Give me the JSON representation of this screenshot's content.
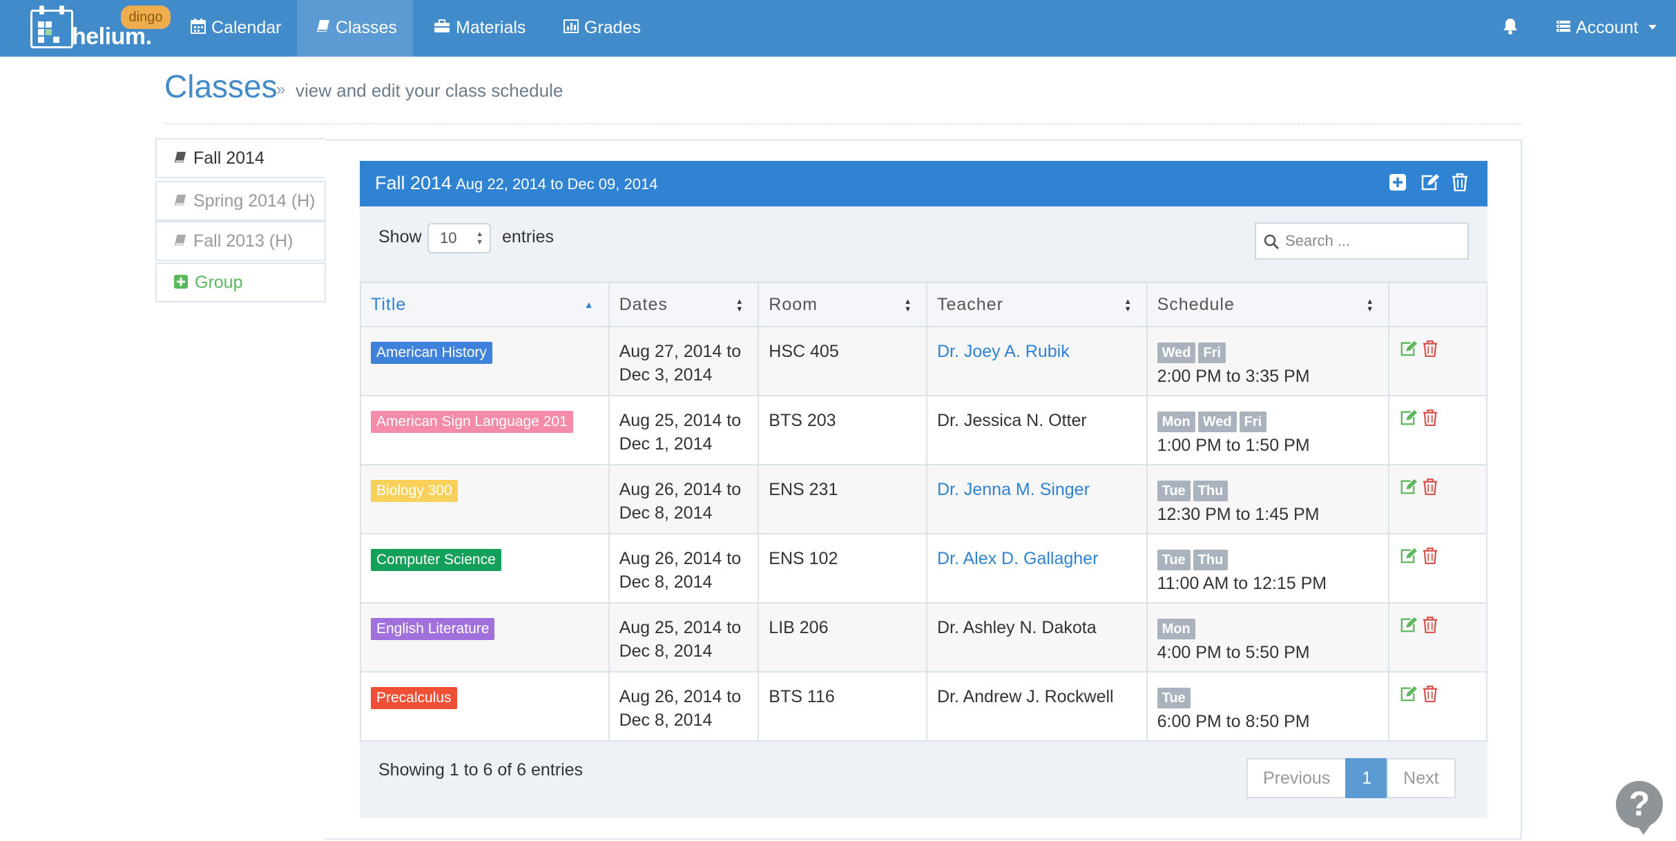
{
  "brand": {
    "name": "helium.",
    "badge": "dingo"
  },
  "nav": {
    "items": [
      {
        "label": "Calendar",
        "icon": "calendar-icon"
      },
      {
        "label": "Classes",
        "icon": "book-icon",
        "active": true
      },
      {
        "label": "Materials",
        "icon": "briefcase-icon"
      },
      {
        "label": "Grades",
        "icon": "bar-chart-icon"
      }
    ],
    "account": "Account"
  },
  "page": {
    "title": "Classes",
    "subtitle": "view and edit your class schedule"
  },
  "terms": [
    {
      "label": "Fall 2014",
      "active": true
    },
    {
      "label": "Spring 2014 (H)"
    },
    {
      "label": "Fall 2013 (H)"
    },
    {
      "label": "Group",
      "type": "add"
    }
  ],
  "panel": {
    "title": "Fall 2014",
    "dates": "Aug 22, 2014 to Dec 09, 2014",
    "show_label": "Show",
    "page_length": "10",
    "entries_label": "entries",
    "search_placeholder": "Search ...",
    "columns": [
      "Title",
      "Dates",
      "Room",
      "Teacher",
      "Schedule"
    ],
    "rows": [
      {
        "title": "American History",
        "color": "#3e82dc",
        "dates_start": "Aug 27, 2014 to",
        "dates_end": "Dec 3, 2014",
        "room": "HSC 405",
        "teacher": "Dr. Joey A. Rubik",
        "teacher_link": true,
        "days": [
          "Wed",
          "Fri"
        ],
        "time": "2:00 PM to 3:35 PM"
      },
      {
        "title": "American Sign Language 201",
        "color": "#f48ba8",
        "dates_start": "Aug 25, 2014 to",
        "dates_end": "Dec 1, 2014",
        "room": "BTS 203",
        "teacher": "Dr. Jessica N. Otter",
        "teacher_link": false,
        "days": [
          "Mon",
          "Wed",
          "Fri"
        ],
        "time": "1:00 PM to 1:50 PM"
      },
      {
        "title": "Biology 300",
        "color": "#f9d05a",
        "dates_start": "Aug 26, 2014 to",
        "dates_end": "Dec 8, 2014",
        "room": "ENS 231",
        "teacher": "Dr. Jenna M. Singer",
        "teacher_link": true,
        "days": [
          "Tue",
          "Thu"
        ],
        "time": "12:30 PM to 1:45 PM"
      },
      {
        "title": "Computer Science",
        "color": "#14a05a",
        "dates_start": "Aug 26, 2014 to",
        "dates_end": "Dec 8, 2014",
        "room": "ENS 102",
        "teacher": "Dr. Alex D. Gallagher",
        "teacher_link": true,
        "days": [
          "Tue",
          "Thu"
        ],
        "time": "11:00 AM to 12:15 PM"
      },
      {
        "title": "English Literature",
        "color": "#a070dd",
        "dates_start": "Aug 25, 2014 to",
        "dates_end": "Dec 8, 2014",
        "room": "LIB 206",
        "teacher": "Dr. Ashley N. Dakota",
        "teacher_link": false,
        "days": [
          "Mon"
        ],
        "time": "4:00 PM to 5:50 PM"
      },
      {
        "title": "Precalculus",
        "color": "#ef4f35",
        "dates_start": "Aug 26, 2014 to",
        "dates_end": "Dec 8, 2014",
        "room": "BTS 116",
        "teacher": "Dr. Andrew J. Rockwell",
        "teacher_link": false,
        "days": [
          "Tue"
        ],
        "time": "6:00 PM to 8:50 PM"
      }
    ],
    "info": "Showing 1 to 6 of 6 entries",
    "pagination": {
      "previous": "Previous",
      "current": "1",
      "next": "Next"
    }
  },
  "colors": {
    "navbar": "#428bca",
    "panel_header": "#2f83d2",
    "edit": "#5cb85c",
    "delete": "#d9534f"
  },
  "help": "?"
}
